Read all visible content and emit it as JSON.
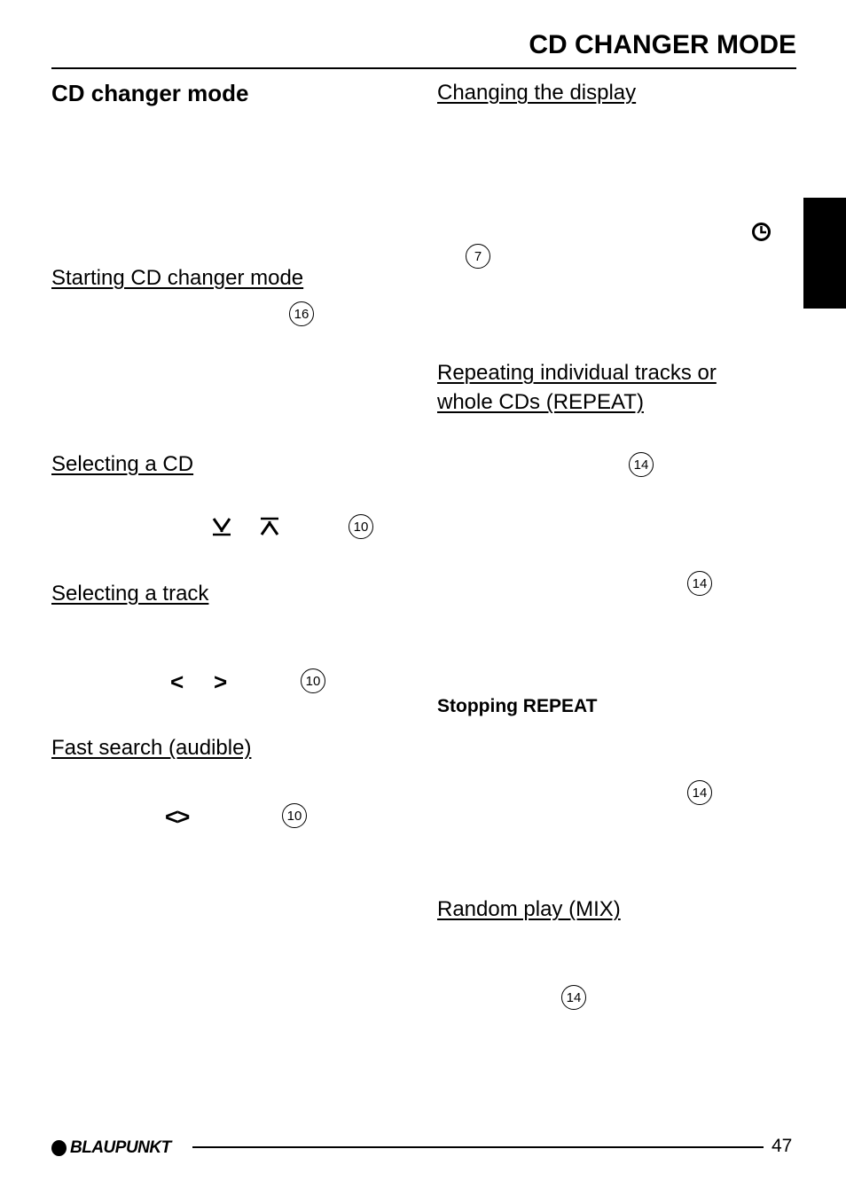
{
  "header": {
    "title": "CD CHANGER MODE"
  },
  "left_column": {
    "section_title": "CD changer mode",
    "sections": [
      {
        "heading": "Starting CD changer mode",
        "callouts": [
          "16"
        ]
      },
      {
        "heading": "Selecting a CD",
        "symbols": [
          "down-skip",
          "up-skip"
        ],
        "callouts": [
          "10"
        ]
      },
      {
        "heading": "Selecting a track",
        "symbols": [
          "<",
          ">"
        ],
        "callouts": [
          "10"
        ]
      },
      {
        "heading": "Fast search (audible)",
        "symbols": [
          "<>"
        ],
        "callouts": [
          "10"
        ]
      }
    ]
  },
  "right_column": {
    "sections": [
      {
        "heading": "Changing the display",
        "icons": [
          "clock-icon"
        ],
        "callouts": [
          "7"
        ]
      },
      {
        "heading": "Repeating individual tracks or whole CDs (REPEAT)",
        "callouts": [
          "14",
          "14"
        ]
      },
      {
        "subheading": "Stopping REPEAT",
        "callouts": [
          "14"
        ]
      },
      {
        "heading": "Random play (MIX)",
        "callouts": [
          "14"
        ]
      }
    ]
  },
  "footer": {
    "brand": "BLAUPUNKT",
    "page_number": "47"
  }
}
